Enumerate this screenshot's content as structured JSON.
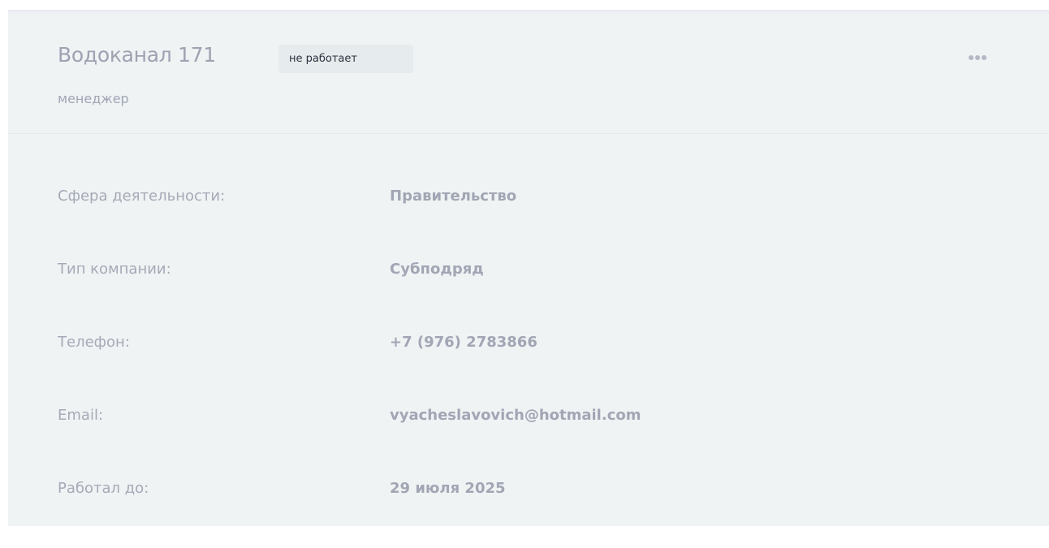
{
  "company": {
    "name": "Водоканал 171",
    "status": "не работает",
    "role": "менеджер",
    "menu_icon": "more-horizontal-icon"
  },
  "details": [
    {
      "label": "Сфера деятельности:",
      "value": "Правительство"
    },
    {
      "label": "Тип компании:",
      "value": "Субподряд"
    },
    {
      "label": "Телефон:",
      "value": "+7 (976) 2783866"
    },
    {
      "label": "Email:",
      "value": "vyacheslavovich@hotmail.com"
    },
    {
      "label": "Работал до:",
      "value": "29 июля 2025"
    }
  ]
}
